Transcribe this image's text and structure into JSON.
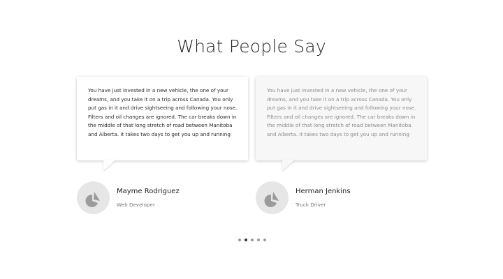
{
  "section": {
    "title": "What People Say"
  },
  "testimonials": [
    {
      "quote": "You have just invested in a new vehicle, the one of your dreams, and you take it on a trip across Canada. You only put gas in it and drive sightseeing and following your nose. Filters and oil changes are ignored. The car breaks down in the middle of that long stretch of road between Manitoba and Alberta. It takes two days to get you up and running",
      "name": "Mayme Rodriguez",
      "role": "Web Developer",
      "avatar_icon": "user-avatar-placeholder-icon"
    },
    {
      "quote": "You have just invested in a new vehicle, the one of your dreams, and you take it on a trip across Canada. You only put gas in it and drive sightseeing and following your nose. Filters and oil changes are ignored. The car breaks down in the middle of that long stretch of road between Manitoba and Alberta. It takes two days to get you up and running",
      "name": "Herman Jenkins",
      "role": "Truck Driver",
      "avatar_icon": "user-avatar-placeholder-icon"
    }
  ],
  "pagination": {
    "count": 5,
    "active_index": 1
  },
  "colors": {
    "title": "#222222",
    "avatar_bg": "#e6e6e6",
    "avatar_shape": "#9b9b9b",
    "dot": "#9a9a9a",
    "dot_active": "#333333"
  }
}
